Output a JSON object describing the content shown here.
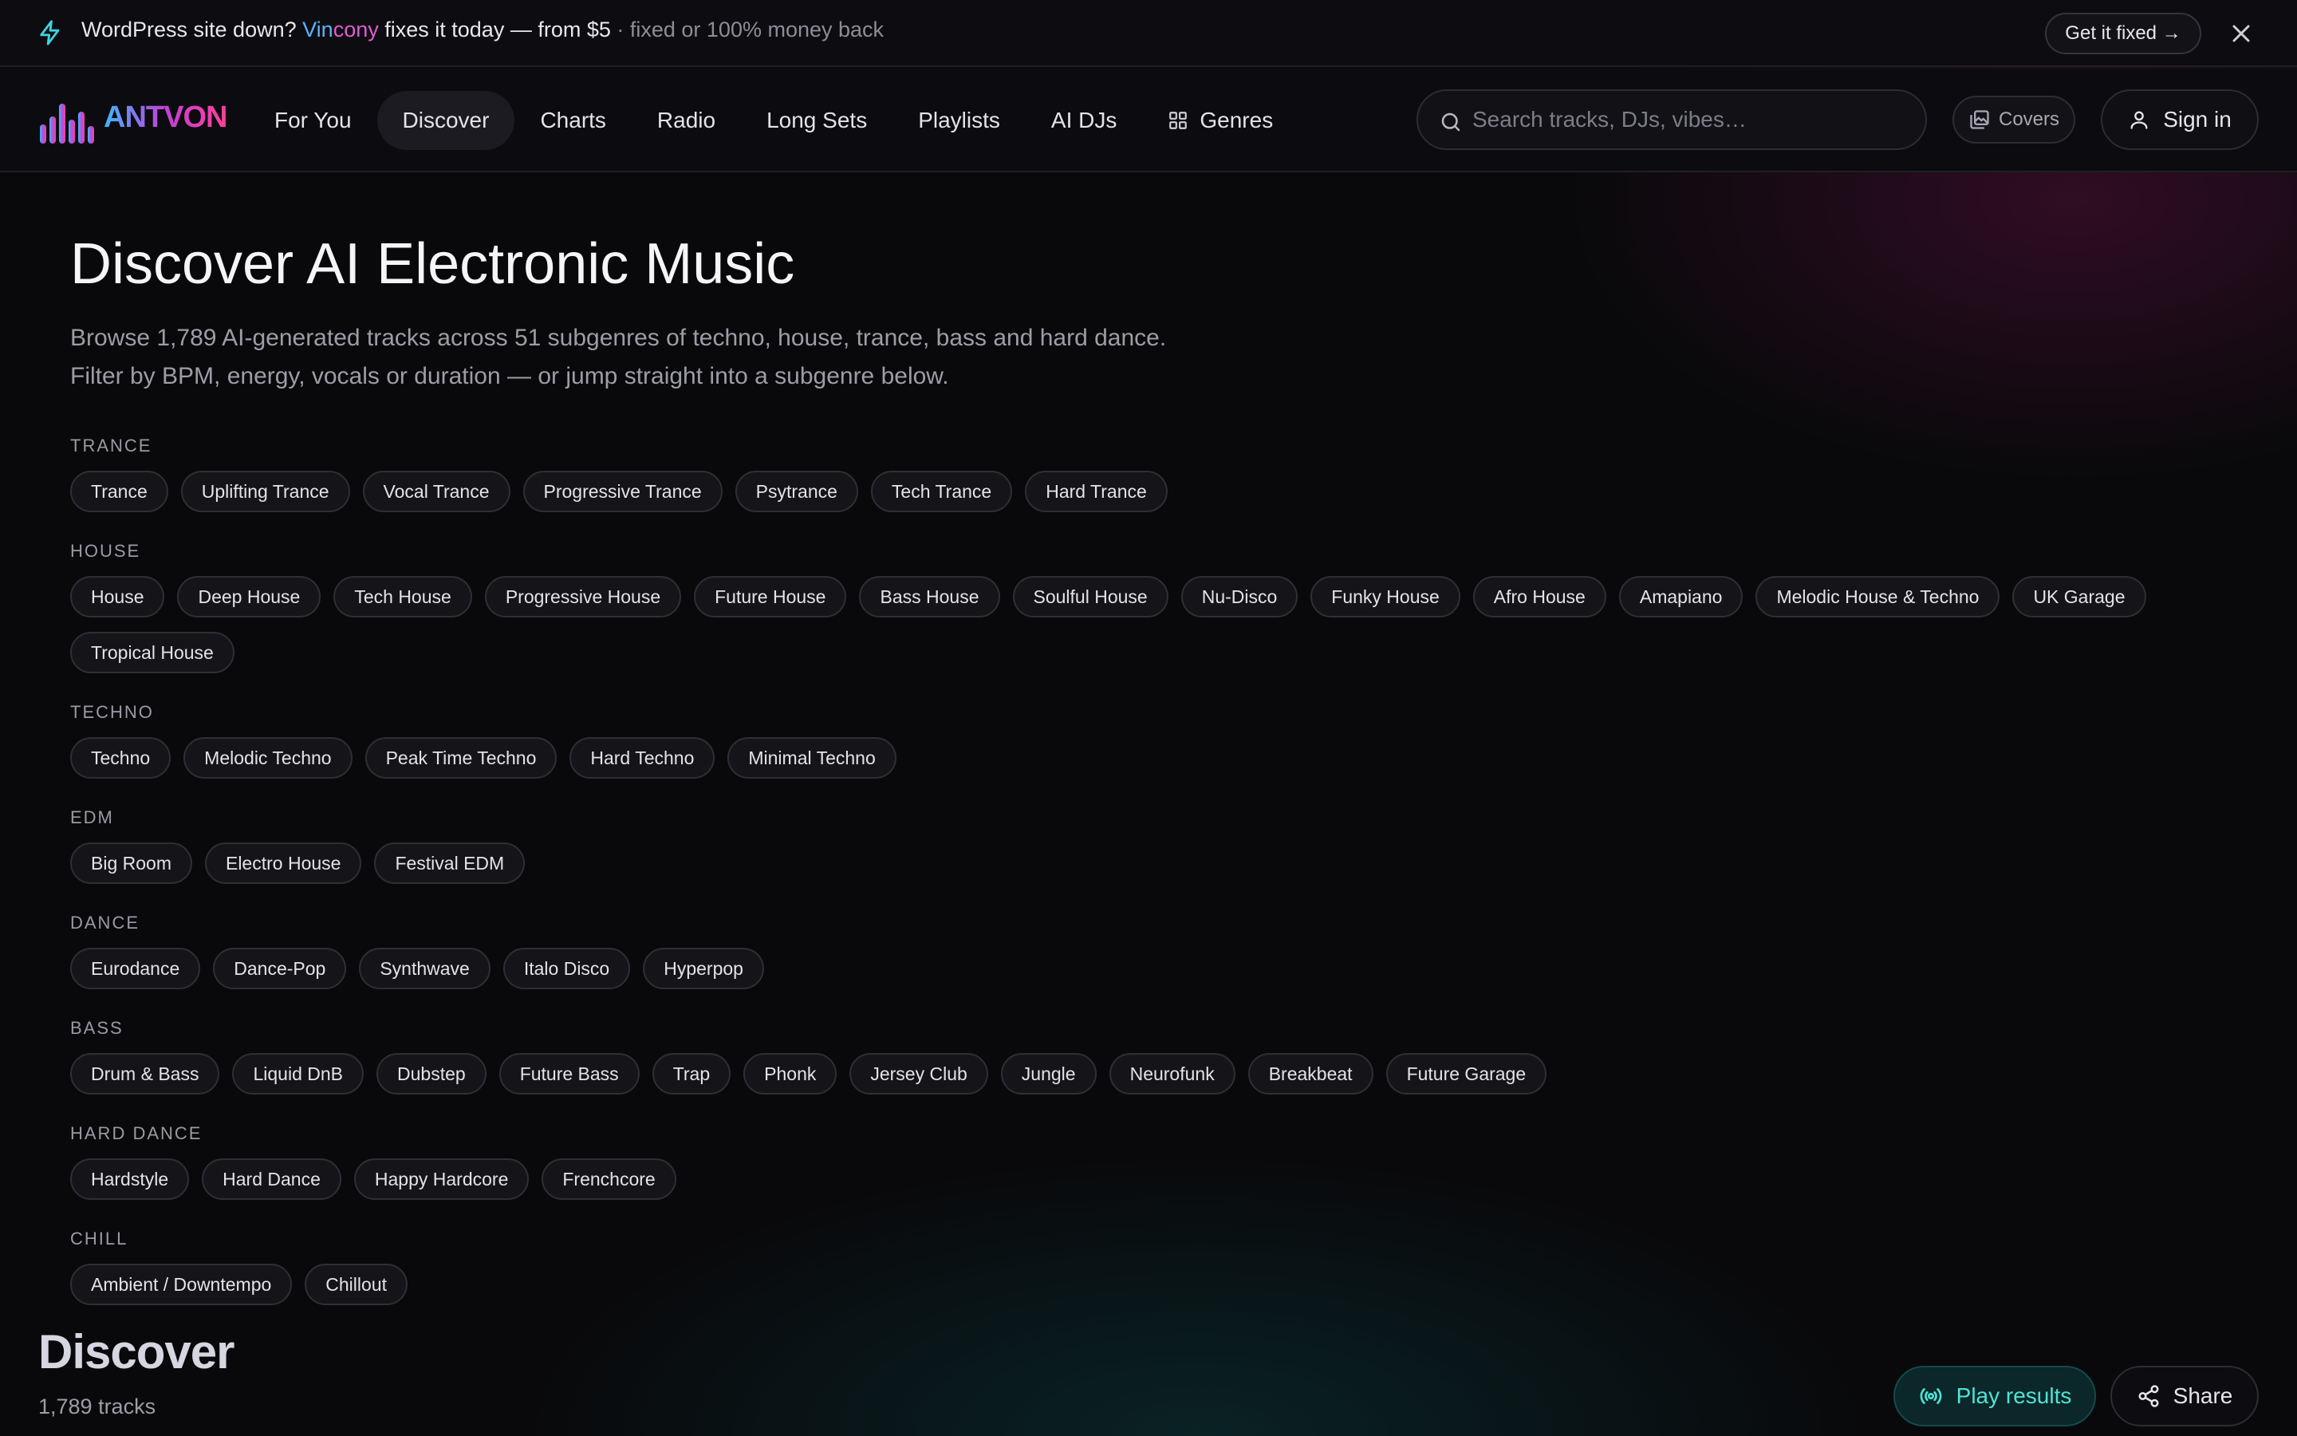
{
  "announcement": {
    "lead": "WordPress site down?",
    "brand_part1": "Vin",
    "brand_part2": "cony",
    "middle": "fixes it today — from $5",
    "muted": "· fixed or 100% money back",
    "cta": "Get it fixed →",
    "icon": "bolt-icon",
    "close_icon": "close-icon"
  },
  "nav": {
    "logo": "ANTVON",
    "links": [
      {
        "label": "For You"
      },
      {
        "label": "Discover",
        "active": true
      },
      {
        "label": "Charts"
      },
      {
        "label": "Radio"
      },
      {
        "label": "Long Sets"
      },
      {
        "label": "Playlists"
      },
      {
        "label": "AI DJs"
      },
      {
        "label": "Genres",
        "icon": "grid-icon"
      }
    ],
    "search_placeholder": "Search tracks, DJs, vibes…",
    "covers": "Covers",
    "sign_in": "Sign in"
  },
  "hero": {
    "title": "Discover AI Electronic Music",
    "subtitle_line1": "Browse 1,789 AI-generated tracks across 51 subgenres of techno, house, trance, bass and hard dance.",
    "subtitle_line2": "Filter by BPM, energy, vocals or duration — or jump straight into a subgenre below."
  },
  "genre_groups": [
    {
      "label": "TRANCE",
      "chips": [
        "Trance",
        "Uplifting Trance",
        "Vocal Trance",
        "Progressive Trance",
        "Psytrance",
        "Tech Trance",
        "Hard Trance"
      ]
    },
    {
      "label": "HOUSE",
      "chips": [
        "House",
        "Deep House",
        "Tech House",
        "Progressive House",
        "Future House",
        "Bass House",
        "Soulful House",
        "Nu-Disco",
        "Funky House",
        "Afro House",
        "Amapiano",
        "Melodic House & Techno",
        "UK Garage",
        "Tropical House"
      ]
    },
    {
      "label": "TECHNO",
      "chips": [
        "Techno",
        "Melodic Techno",
        "Peak Time Techno",
        "Hard Techno",
        "Minimal Techno"
      ]
    },
    {
      "label": "EDM",
      "chips": [
        "Big Room",
        "Electro House",
        "Festival EDM"
      ]
    },
    {
      "label": "DANCE",
      "chips": [
        "Eurodance",
        "Dance-Pop",
        "Synthwave",
        "Italo Disco",
        "Hyperpop"
      ]
    },
    {
      "label": "BASS",
      "chips": [
        "Drum & Bass",
        "Liquid DnB",
        "Dubstep",
        "Future Bass",
        "Trap",
        "Phonk",
        "Jersey Club",
        "Jungle",
        "Neurofunk",
        "Breakbeat",
        "Future Garage"
      ]
    },
    {
      "label": "HARD DANCE",
      "chips": [
        "Hardstyle",
        "Hard Dance",
        "Happy Hardcore",
        "Frenchcore"
      ]
    },
    {
      "label": "CHILL",
      "chips": [
        "Ambient / Downtempo",
        "Chillout"
      ]
    }
  ],
  "results": {
    "title": "Discover",
    "count": "1,789 tracks",
    "play": "Play results",
    "share": "Share"
  },
  "colors": {
    "accent_teal": "#4fe3d6",
    "brand_blue": "#59b3ff",
    "brand_pink": "#e15bd0",
    "background": "#09090b"
  }
}
